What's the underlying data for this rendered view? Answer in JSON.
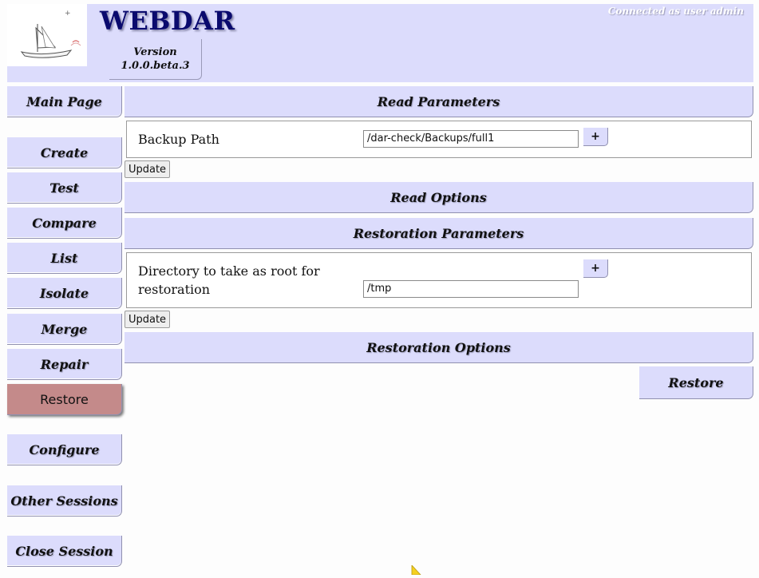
{
  "header": {
    "title": "WEBDAR",
    "version_label": "Version",
    "version": "1.0.0.beta.3",
    "connected": "Connected as user admin"
  },
  "menu": {
    "main_page": "Main Page",
    "create": "Create",
    "test": "Test",
    "compare": "Compare",
    "list": "List",
    "isolate": "Isolate",
    "merge": "Merge",
    "repair": "Repair",
    "restore": "Restore",
    "configure": "Configure",
    "other_sessions": "Other Sessions",
    "close_session": "Close Session",
    "active_item": "Restore"
  },
  "main": {
    "read_parameters": "Read Parameters",
    "backup_path_label": "Backup Path",
    "backup_path_value": "/dar-check/Backups/full1",
    "plus_label": "+",
    "update_label": "Update",
    "read_options": "Read Options",
    "restoration_parameters": "Restoration Parameters",
    "root_dir_label_line1": "Directory to take as root for",
    "root_dir_label_line2": "restoration",
    "root_dir_value": "/tmp",
    "restoration_options": "Restoration Options",
    "restore_button": "Restore"
  },
  "colors": {
    "panel": "#dcdcfc",
    "active_menu": "#c48a8a",
    "title": "#0a0a6e"
  }
}
